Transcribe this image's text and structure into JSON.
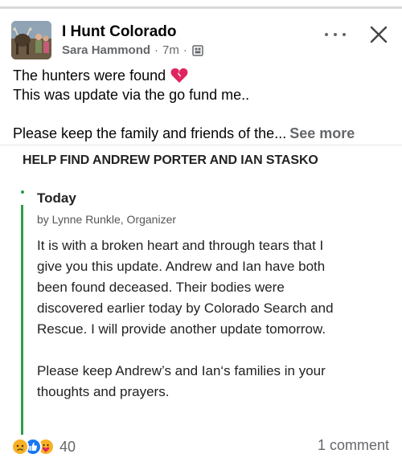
{
  "post": {
    "group_name": "I Hunt Colorado",
    "author": "Sara Hammond",
    "separator": "·",
    "time": "7m",
    "text_line1": "The hunters were found",
    "text_line2": "This was update via the go fund me..",
    "text_line3": "Please keep the family and friends of the...",
    "see_more_label": "See more"
  },
  "card": {
    "title": "HELP FIND ANDREW PORTER AND IAN STASKO",
    "update_title": "Today",
    "byline": "by Lynne Runkle, Organizer",
    "body_lines": [
      "It is with a broken heart and through tears that I",
      "give you this update. Andrew and Ian have both",
      "been found deceased. Their bodies were",
      "discovered earlier today by Colorado Search and",
      "Rescue. I will provide another update tomorrow."
    ],
    "body_lines_2": [
      "Please keep Andrew’s and Ian‘s families in your",
      "thoughts and prayers."
    ]
  },
  "footer": {
    "reaction_count": "40",
    "comment_count_label": "1 comment"
  },
  "icons": {
    "more": "more-horizontal-icon",
    "close": "close-icon",
    "privacy": "group-privacy-icon",
    "heart": "broken-heart-icon",
    "reactions": [
      "sad-reaction-icon",
      "like-reaction-icon",
      "care-reaction-icon"
    ]
  },
  "colors": {
    "accent_green": "#2e9e48",
    "like_blue": "#1877f2",
    "muted_text": "#65676b"
  }
}
